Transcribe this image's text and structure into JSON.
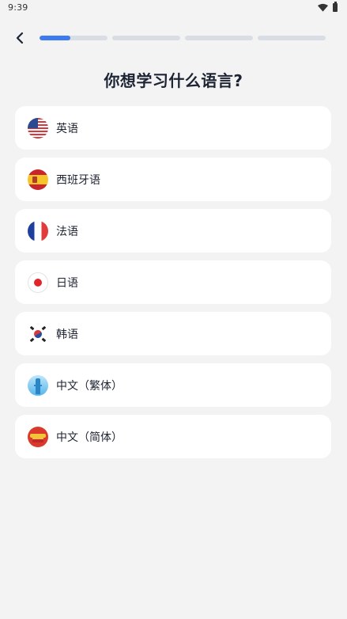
{
  "status_bar": {
    "time": "9:39",
    "icons": [
      "wifi-icon",
      "battery-icon"
    ]
  },
  "header": {
    "back_icon": "chevron-left-icon",
    "progress": {
      "segments": 4,
      "current_segment_fill": 0.45
    }
  },
  "title": "你想学习什么语言?",
  "languages": [
    {
      "label": "英语",
      "flag": "us-flag-icon"
    },
    {
      "label": "西班牙语",
      "flag": "spain-flag-icon"
    },
    {
      "label": "法语",
      "flag": "france-flag-icon"
    },
    {
      "label": "日语",
      "flag": "japan-flag-icon"
    },
    {
      "label": "韩语",
      "flag": "korea-flag-icon"
    },
    {
      "label": "中文（繁体）",
      "flag": "taipei-tower-icon"
    },
    {
      "label": "中文（简体）",
      "flag": "china-gate-icon"
    }
  ],
  "colors": {
    "accent": "#3e7bf0",
    "background": "#f3f3f4",
    "card": "#ffffff",
    "track": "#d9dde5"
  }
}
